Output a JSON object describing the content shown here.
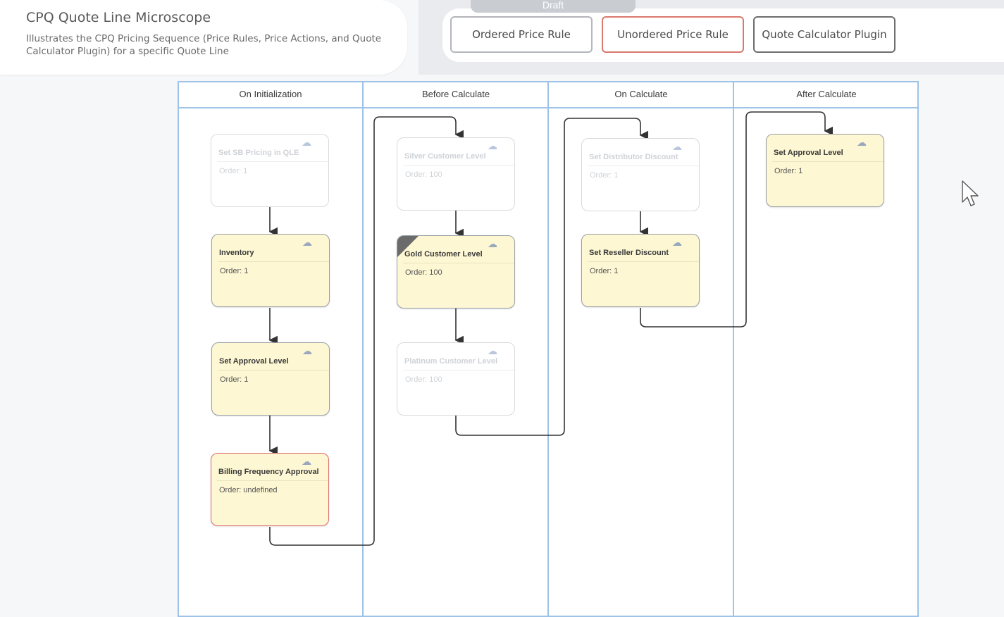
{
  "header": {
    "title": "CPQ Quote Line Microscope",
    "subtitle": "Illustrates the CPQ Pricing Sequence (Price Rules, Price Actions, and Quote Calculator Plugin) for a specific Quote Line"
  },
  "status_tab": "Draft",
  "legend": {
    "ordered_price_rule": "Ordered Price Rule",
    "unordered_price_rule": "Unordered Price Rule",
    "quote_calculator_plugin": "Quote Calculator Plugin"
  },
  "lanes": [
    {
      "title": "On Initialization"
    },
    {
      "title": "Before Calculate"
    },
    {
      "title": "On Calculate"
    },
    {
      "title": "After Calculate"
    }
  ],
  "nodes": {
    "init_sb_pricing": {
      "title": "Set SB Pricing in QLE",
      "order": "Order: 1"
    },
    "init_inventory": {
      "title": "Inventory",
      "order": "Order: 1"
    },
    "init_set_approval": {
      "title": "Set Approval Level",
      "order": "Order: 1"
    },
    "init_billing_frequency": {
      "title": "Billing Frequency Approval",
      "order": "Order: undefined"
    },
    "before_silver": {
      "title": "Silver Customer Level",
      "order": "Order: 100"
    },
    "before_gold": {
      "title": "Gold Customer Level",
      "order": "Order: 100"
    },
    "before_platinum": {
      "title": "Platinum Customer Level",
      "order": "Order: 100"
    },
    "calc_distributor": {
      "title": "Set Distributor Discount",
      "order": "Order: 1"
    },
    "calc_reseller": {
      "title": "Set Reseller Discount",
      "order": "Order: 1"
    },
    "after_set_approval": {
      "title": "Set Approval Level",
      "order": "Order: 1"
    }
  },
  "icons": {
    "node_icon": "refresh-cloud-icon",
    "cursor": "mouse-pointer-icon"
  },
  "colors": {
    "lane_border": "#9fc3e7",
    "active_node_fill": "#fdf7d3",
    "unordered_border": "#e06b6b"
  }
}
